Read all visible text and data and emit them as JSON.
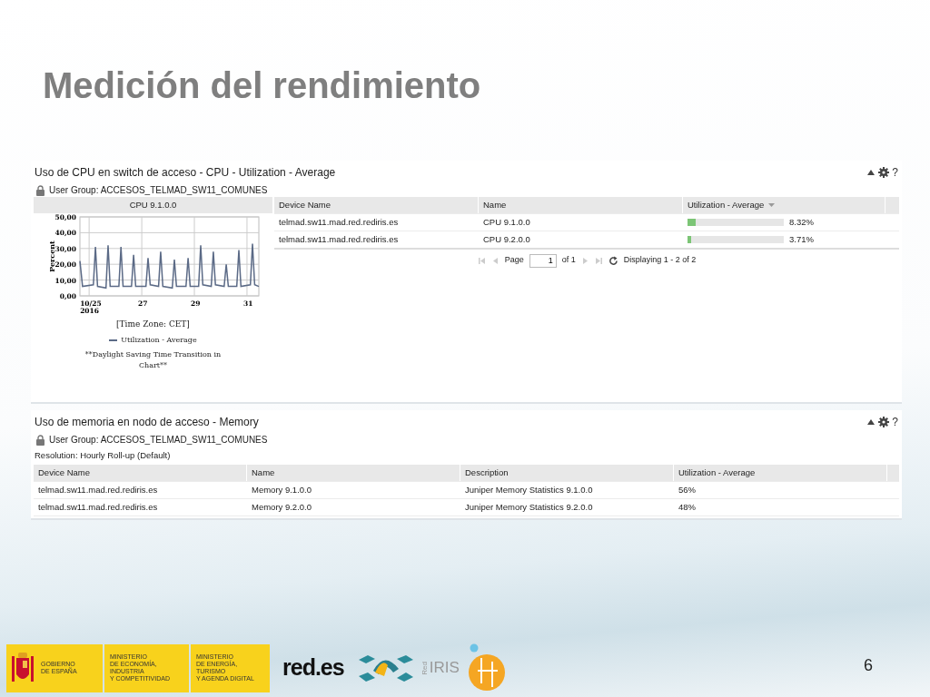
{
  "slide": {
    "title": "Medición del rendimiento",
    "page_number": "6"
  },
  "panels": [
    {
      "kind": "chart_table",
      "title": "Uso de CPU en switch de acceso - CPU - Utilization - Average",
      "help": "?",
      "user_group": "User Group: ACCESOS_TELMAD_SW11_COMUNES",
      "chart": {
        "header": "CPU 9.1.0.0",
        "time_zone": "[Time Zone: CET]",
        "note": "**Daylight Saving Time Transition in Chart**",
        "chart_data": {
          "type": "line",
          "grid": true,
          "ylabel": "Percent",
          "xlim": [
            24.65,
            31.45
          ],
          "ylim": [
            0,
            50
          ],
          "xticks": [
            {
              "value": 25,
              "label": "10/25\n2016"
            },
            {
              "value": 27,
              "label": "27"
            },
            {
              "value": 29,
              "label": "29"
            },
            {
              "value": 31,
              "label": "31"
            }
          ],
          "yticks": [
            {
              "value": 0,
              "label": "0,00"
            },
            {
              "value": 10,
              "label": "10,00"
            },
            {
              "value": 20,
              "label": "20,00"
            },
            {
              "value": 30,
              "label": "30,00"
            },
            {
              "value": 40,
              "label": "40,00"
            },
            {
              "value": 50,
              "label": "50,00"
            }
          ],
          "x": [
            24.65,
            24.75,
            25.16,
            25.24,
            25.32,
            25.64,
            25.72,
            25.8,
            26.13,
            26.21,
            26.29,
            26.61,
            26.69,
            26.77,
            27.16,
            27.24,
            27.32,
            27.64,
            27.72,
            27.8,
            28.16,
            28.24,
            28.32,
            28.68,
            28.76,
            28.84,
            29.16,
            29.24,
            29.32,
            29.64,
            29.72,
            29.8,
            30.13,
            30.21,
            30.29,
            30.61,
            30.69,
            30.77,
            31.13,
            31.21,
            31.29,
            31.45
          ],
          "series": [
            {
              "name": "Utilization - Average",
              "color": "#5b6a86",
              "values": [
                22,
                6,
                7,
                31,
                6,
                5,
                32,
                6,
                6,
                31,
                6,
                6,
                26,
                6,
                6,
                24,
                7,
                6,
                28,
                6,
                5,
                23,
                6,
                6,
                24,
                6,
                6,
                32,
                7,
                6,
                28,
                7,
                6,
                20,
                6,
                6,
                29,
                6,
                7,
                33,
                7,
                6
              ]
            }
          ]
        }
      },
      "columns": [
        {
          "label": "Device Name",
          "sorted": false
        },
        {
          "label": "Name",
          "sorted": false
        },
        {
          "label": "Utilization - Average",
          "sorted": true
        }
      ],
      "rows": [
        {
          "device": "telmad.sw11.mad.red.rediris.es",
          "name": "CPU 9.1.0.0",
          "level": 0.0832,
          "reading": "8.32%"
        },
        {
          "device": "telmad.sw11.mad.red.rediris.es",
          "name": "CPU 9.2.0.0",
          "level": 0.0371,
          "reading": "3.71%"
        }
      ],
      "pager": {
        "page_label": "Page",
        "page": "1",
        "of": "of 1",
        "displaying": "Displaying 1 - 2 of 2"
      }
    },
    {
      "kind": "table",
      "title": "Uso de memoria en nodo de acceso - Memory",
      "help": "?",
      "user_group": "User Group: ACCESOS_TELMAD_SW11_COMUNES",
      "resolution": "Resolution: Hourly Roll-up (Default)",
      "columns": [
        {
          "label": "Device Name"
        },
        {
          "label": "Name"
        },
        {
          "label": "Description"
        },
        {
          "label": "Utilization - Average"
        }
      ],
      "rows": [
        {
          "cells": [
            "telmad.sw11.mad.red.rediris.es",
            "Memory 9.1.0.0",
            "Juniper Memory Statistics 9.1.0.0",
            "56%"
          ]
        },
        {
          "cells": [
            "telmad.sw11.mad.red.rediris.es",
            "Memory 9.2.0.0",
            "Juniper Memory Statistics 9.2.0.0",
            "48%"
          ]
        }
      ]
    }
  ],
  "footer": {
    "logos": [
      {
        "kind": "gobierno",
        "lines": [
          "GOBIERNO",
          "DE ESPAÑA"
        ]
      },
      {
        "kind": "ministry",
        "lines": [
          "MINISTERIO",
          "DE ECONOMÍA, INDUSTRIA",
          "Y COMPETITIVIDAD"
        ]
      },
      {
        "kind": "ministry",
        "lines": [
          "MINISTERIO",
          "DE ENERGÍA, TURISMO",
          "Y AGENDA DIGITAL"
        ]
      },
      {
        "kind": "wordmark",
        "text": "red.es"
      },
      {
        "kind": "mark"
      },
      {
        "kind": "rediris",
        "prefix": "Red",
        "text": "IRIS"
      },
      {
        "kind": "circle"
      }
    ]
  }
}
